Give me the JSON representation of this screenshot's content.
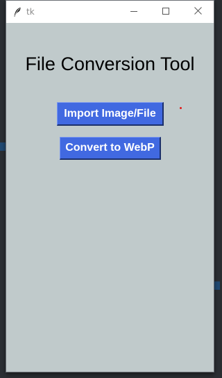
{
  "window": {
    "title": "tk",
    "icons": {
      "app": "feather-icon",
      "minimize": "minimize-icon",
      "maximize": "maximize-icon",
      "close": "close-icon"
    }
  },
  "main": {
    "heading": "File Conversion Tool",
    "import_button_label": "Import Image/File",
    "convert_button_label": "Convert to WebP"
  },
  "colors": {
    "window_background": "#c0cacb",
    "button_background": "#4169e1",
    "button_text": "#ffffff",
    "titlebar": "#ffffff",
    "indicator_dot": "#e11b1b"
  }
}
